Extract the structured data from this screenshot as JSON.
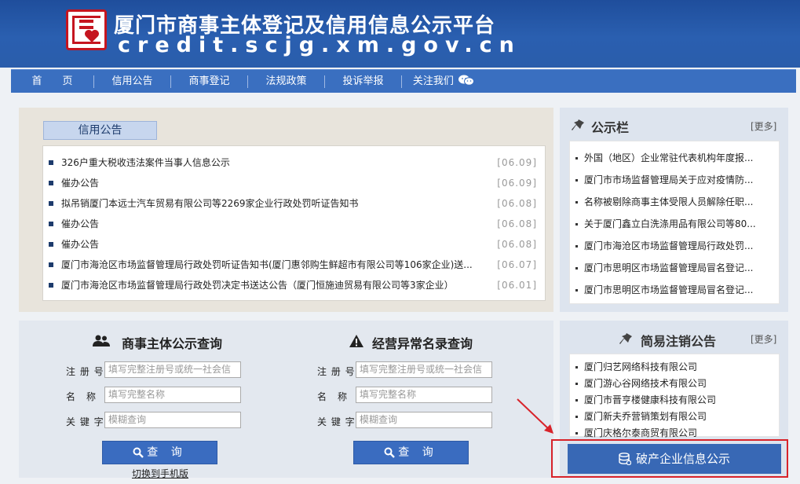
{
  "header": {
    "title": "厦门市商事主体登记及信用信息公示平台",
    "url": "credit.scjg.xm.gov.cn"
  },
  "nav": [
    {
      "label": "首　　页"
    },
    {
      "label": "信用公告"
    },
    {
      "label": "商事登记"
    },
    {
      "label": "法规政策"
    },
    {
      "label": "投诉举报"
    },
    {
      "label": "关注我们"
    }
  ],
  "credit_announcements": {
    "tab": "信用公告",
    "items": [
      {
        "text": "326户重大税收违法案件当事人信息公示",
        "date": "[06.09]"
      },
      {
        "text": "催办公告",
        "date": "[06.09]"
      },
      {
        "text": "拟吊销厦门本远士汽车贸易有限公司等2269家企业行政处罚听证告知书",
        "date": "[06.08]"
      },
      {
        "text": "催办公告",
        "date": "[06.08]"
      },
      {
        "text": "催办公告",
        "date": "[06.08]"
      },
      {
        "text": "厦门市海沧区市场监督管理局行政处罚听证告知书(厦门惠邻购生鲜超市有限公司等106家企业)送...",
        "date": "[06.07]"
      },
      {
        "text": "厦门市海沧区市场监督管理局行政处罚决定书送达公告（厦门恒施迪贸易有限公司等3家企业）",
        "date": "[06.01]"
      }
    ]
  },
  "bulletin": {
    "title": "公示栏",
    "more": "[更多]",
    "items": [
      "外国（地区）企业常驻代表机构年度报...",
      "厦门市市场监督管理局关于应对疫情防...",
      "名称被剔除商事主体受限人员解除任职...",
      "关于厦门鑫立白洗涤用品有限公司等80...",
      "厦门市海沧区市场监督管理局行政处罚...",
      "厦门市思明区市场监督管理局冒名登记...",
      "厦门市思明区市场监督管理局冒名登记..."
    ]
  },
  "entity_query": {
    "title": "商事主体公示查询",
    "reg_label": "注 册 号",
    "reg_placeholder": "填写完整注册号或统一社会信",
    "name_label": "名　称",
    "name_placeholder": "填写完整名称",
    "keyword_label": "关 键 字",
    "keyword_placeholder": "模糊查询",
    "button": "查 询",
    "switch_mobile": "切换到手机版"
  },
  "abnormal_query": {
    "title": "经营异常名录查询",
    "reg_label": "注 册 号",
    "reg_placeholder": "填写完整注册号或统一社会信",
    "name_label": "名　称",
    "name_placeholder": "填写完整名称",
    "keyword_label": "关 键 字",
    "keyword_placeholder": "模糊查询",
    "button": "查 询"
  },
  "cancellation": {
    "title": "简易注销公告",
    "more": "[更多]",
    "items": [
      "厦门归艺网络科技有限公司",
      "厦门游心谷网络技术有限公司",
      "厦门市晋亨楼健康科技有限公司",
      "厦门新夫乔营销策划有限公司",
      "厦门庆格尔泰商贸有限公司"
    ]
  },
  "bankrupt_button": "破产企业信息公示",
  "colors": {
    "header": "#2a5fb0",
    "nav": "#3a6fc0",
    "accent_red": "#d8232a",
    "button": "#3a6cc0"
  }
}
